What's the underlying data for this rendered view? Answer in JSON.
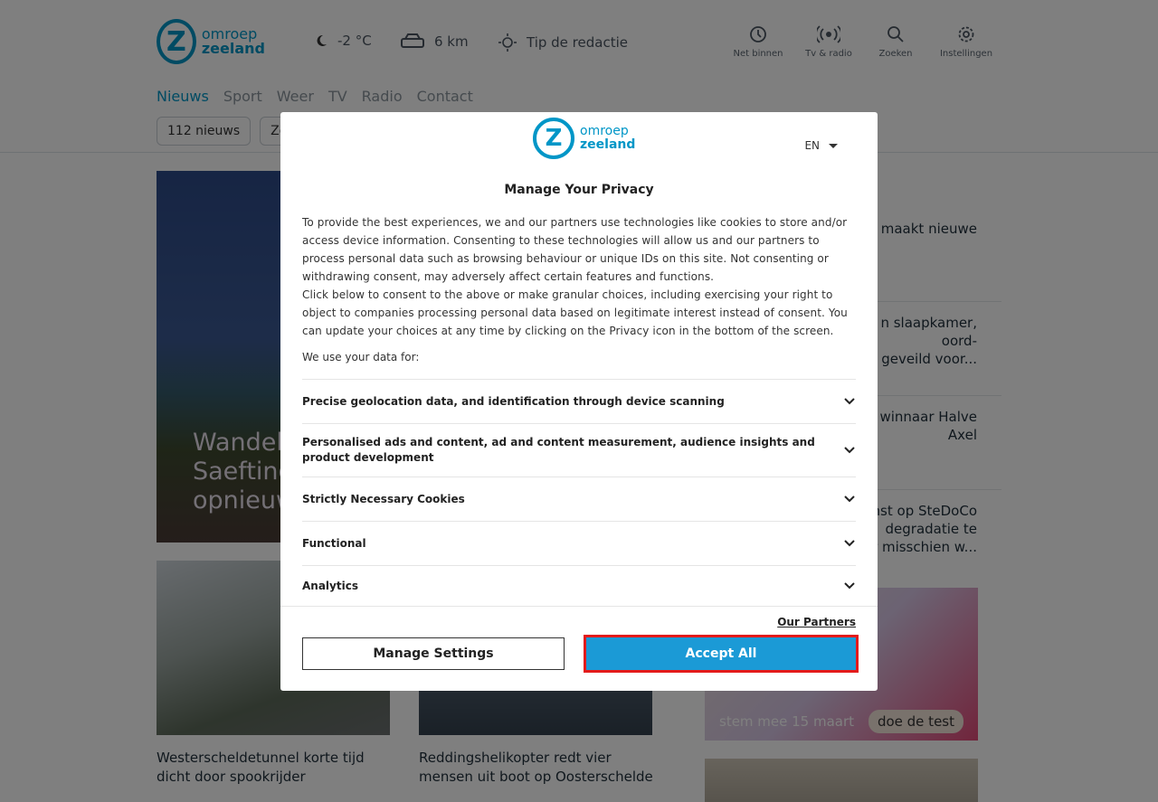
{
  "brand": {
    "line1": "omroep",
    "line2": "zeeland",
    "mark": "Z",
    "color": "#0096c7"
  },
  "weather": {
    "temp": "-2 °C",
    "traffic": "6 km",
    "tip": "Tip de redactie"
  },
  "tools": [
    {
      "label": "Net binnen",
      "icon": "clock-icon"
    },
    {
      "label": "Tv & radio",
      "icon": "broadcast-icon"
    },
    {
      "label": "Zoeken",
      "icon": "search-icon"
    },
    {
      "label": "Instellingen",
      "icon": "gear-icon"
    }
  ],
  "nav": [
    "Nieuws",
    "Sport",
    "Weer",
    "TV",
    "Radio",
    "Contact"
  ],
  "subnav": [
    "112 nieuws",
    "Zee"
  ],
  "hero": {
    "title_line1": "Wandel",
    "title_line2": "Saefting",
    "title_line3": "opnieuw"
  },
  "cards": [
    {
      "title": "Westerscheldetunnel korte tijd dicht door spookrijder"
    },
    {
      "title": "Reddingshelikopter redt vier mensen uit boot op Oosterschelde"
    }
  ],
  "sidebar": {
    "heading": "",
    "items": [
      {
        "line1": "maakt nieuwe",
        "line2": ""
      },
      {
        "line1": "n slaapkamer,",
        "line2": "oord-",
        "line3": "geveild voor..."
      },
      {
        "line1": "e winnaar Halve",
        "line2": "Axel"
      },
      {
        "line1": "winst op SteDoCo",
        "line2": "degradatie te",
        "line3": "er misschien w..."
      }
    ],
    "promo_left": "stem mee 15 maart",
    "promo_right": "doe de test"
  },
  "modal": {
    "language": "EN",
    "title": "Manage Your Privacy",
    "description": "To provide the best experiences, we and our partners use technologies like cookies to store and/or access device information. Consenting to these technologies will allow us and our partners to process personal data such as browsing behaviour or unique IDs on this site. Not consenting or withdrawing consent, may adversely affect certain features and functions.\nClick below to consent to the above or make granular choices, including exercising your right to object to companies processing personal data based on legitimate interest instead of consent. You can update your choices at any time by clicking on the Privacy icon in the bottom of the screen.",
    "use_label": "We use your data for:",
    "purposes": [
      "Precise geolocation data, and identification through device scanning",
      "Personalised ads and content, ad and content measurement, audience insights and product development",
      "Strictly Necessary Cookies",
      "Functional",
      "Analytics"
    ],
    "partners_link": "Our Partners",
    "manage_label": "Manage Settings",
    "accept_label": "Accept All"
  }
}
